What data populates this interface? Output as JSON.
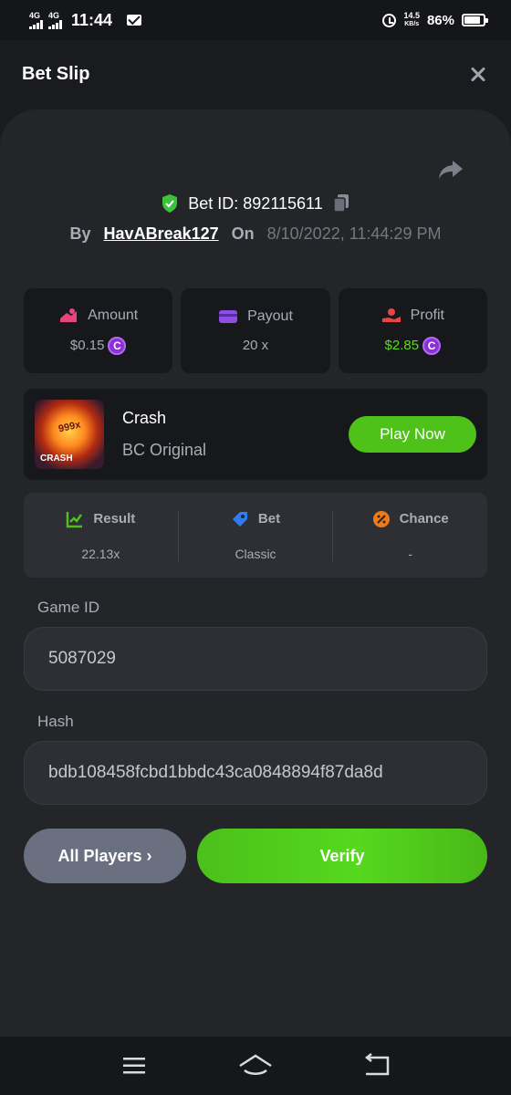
{
  "status_bar": {
    "network_1": "4G",
    "network_2": "4G",
    "time": "11:44",
    "speed_value": "14.5",
    "speed_unit": "KB/s",
    "battery": "86%"
  },
  "header": {
    "title": "Bet Slip"
  },
  "bet": {
    "id_label": "Bet ID: 892115611",
    "by_label": "By",
    "user": "HavABreak127",
    "on_label": "On",
    "date": "8/10/2022, 11:44:29 PM"
  },
  "stats": [
    {
      "label": "Amount",
      "value": "$0.15",
      "color": "#e8457a"
    },
    {
      "label": "Payout",
      "value": "20 x",
      "color": "#8f4de8"
    },
    {
      "label": "Profit",
      "value": "$2.85",
      "color": "#e84545"
    }
  ],
  "coin_symbol": "C",
  "game": {
    "name": "Crash",
    "subtitle": "BC Original",
    "thumb_multiplier": "999x",
    "thumb_label": "CRASH",
    "play_label": "Play Now"
  },
  "results": [
    {
      "label": "Result",
      "value": "22.13x",
      "icon": "chart-check-icon"
    },
    {
      "label": "Bet",
      "value": "Classic",
      "icon": "bet-tag-icon"
    },
    {
      "label": "Chance",
      "value": "-",
      "icon": "percent-icon"
    }
  ],
  "fields": {
    "game_id_label": "Game ID",
    "game_id_value": "5087029",
    "hash_label": "Hash",
    "hash_value": "bdb108458fcbd1bbdc43ca0848894f87da8d"
  },
  "actions": {
    "all_players": "All Players ›",
    "verify": "Verify"
  },
  "colors": {
    "accent_green": "#4fc21a",
    "background": "#1a1b1e",
    "sheet": "#232529"
  }
}
